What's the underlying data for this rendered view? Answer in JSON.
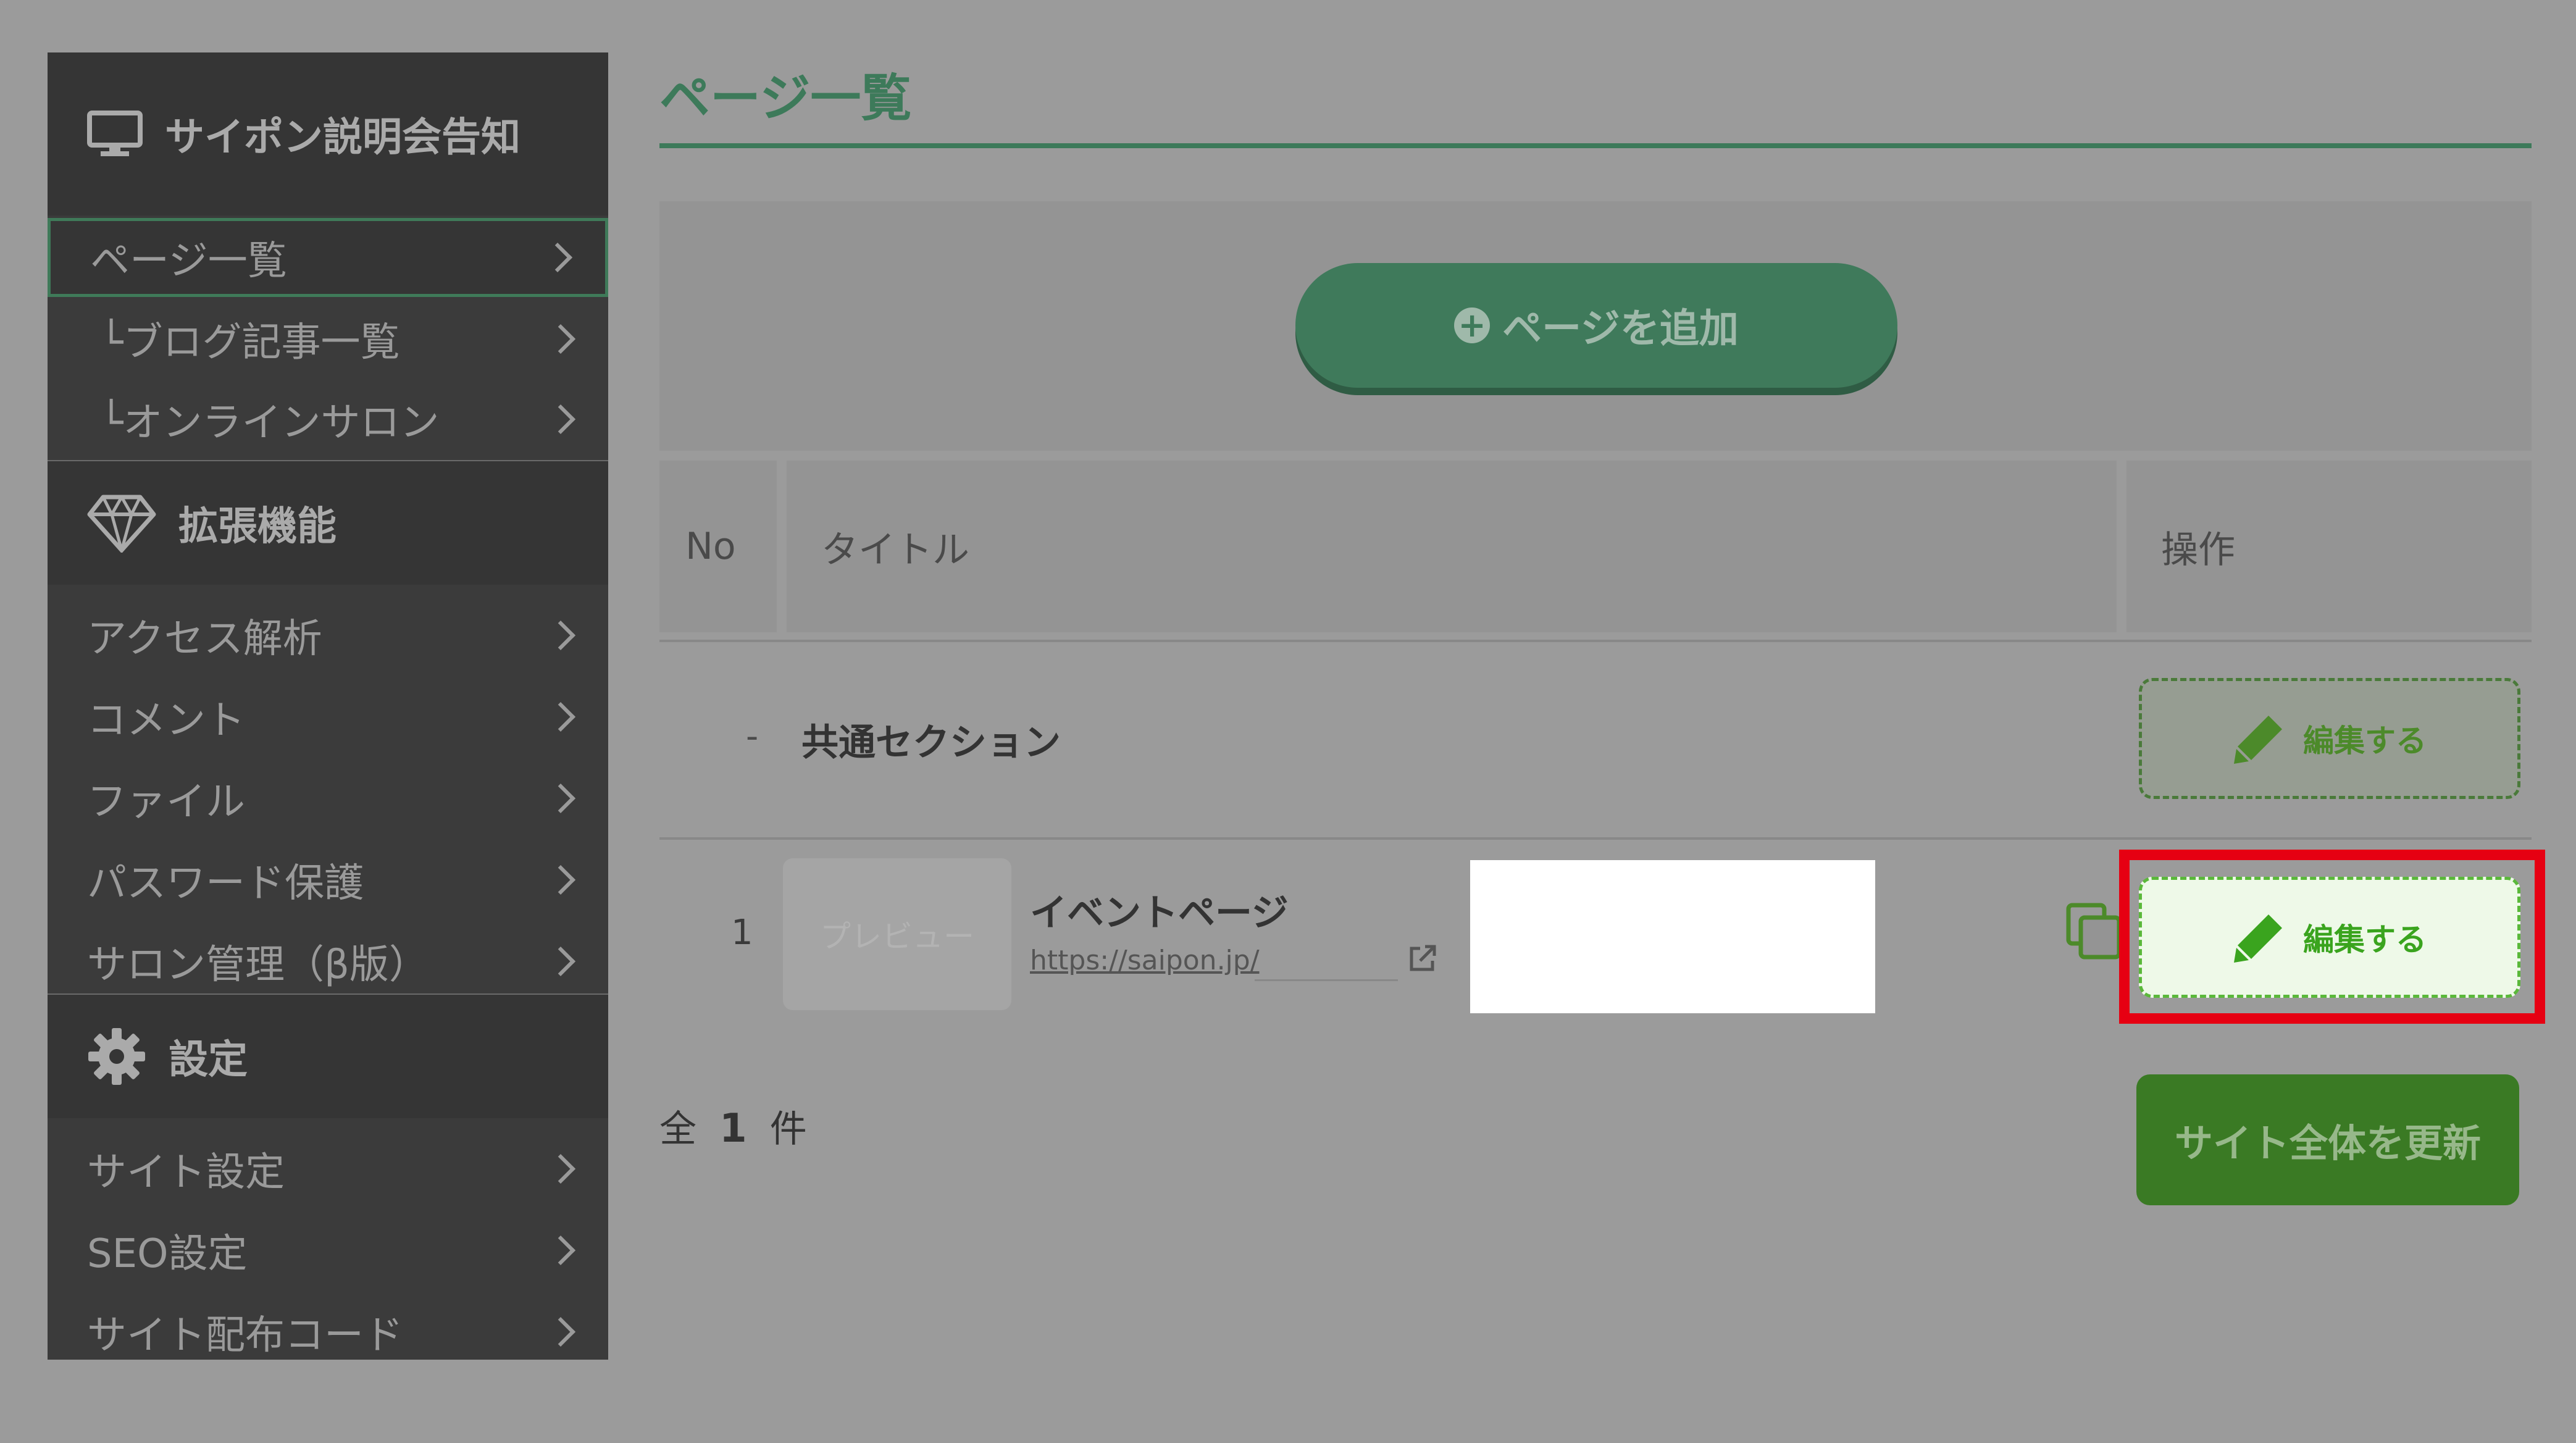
{
  "sidebar": {
    "app_title": "サイポン説明会告知",
    "app_icon": "monitor-icon",
    "pages_group": [
      {
        "label": "ページ一覧",
        "active": true
      },
      {
        "label": "└ブログ記事一覧",
        "active": false
      },
      {
        "label": "└オンラインサロン",
        "active": false
      }
    ],
    "extension_header": "拡張機能",
    "extension_icon": "diamond-icon",
    "extension_items": [
      {
        "label": "アクセス解析"
      },
      {
        "label": "コメント"
      },
      {
        "label": "ファイル"
      },
      {
        "label": "パスワード保護"
      },
      {
        "label": "サロン管理（β版）"
      }
    ],
    "settings_header": "設定",
    "settings_icon": "gear-icon",
    "settings_items": [
      {
        "label": "サイト設定"
      },
      {
        "label": "SEO設定"
      },
      {
        "label": "サイト配布コード"
      }
    ]
  },
  "main": {
    "title": "ページ一覧",
    "add_button": "ページを追加",
    "table": {
      "headers": {
        "no": "No",
        "title": "タイトル",
        "ops": "操作"
      },
      "common_row": {
        "dash": "-",
        "label": "共通セクション",
        "edit": "編集する"
      },
      "rows": [
        {
          "no": "1",
          "preview": "プレビュー",
          "title": "イベントページ",
          "url": "https://saipon.jp/",
          "edit": "編集する"
        }
      ]
    },
    "total": {
      "prefix": "全",
      "count": "1",
      "suffix": "件"
    },
    "update_button": "サイト全体を更新"
  },
  "colors": {
    "accent_green": "#3d7a5a",
    "edit_green": "#3aa41e",
    "highlight_red": "#e60012"
  }
}
